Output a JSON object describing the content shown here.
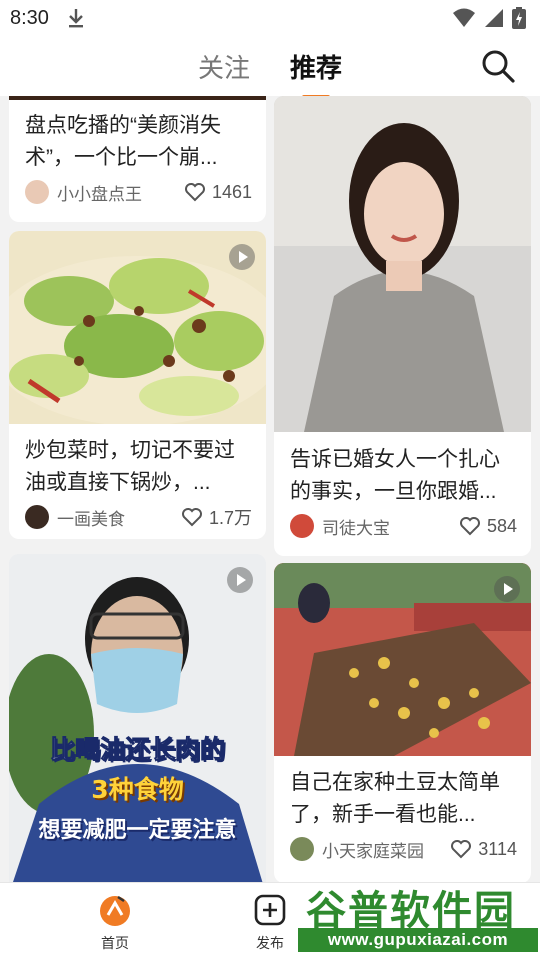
{
  "status": {
    "time": "8:30"
  },
  "tabs": [
    {
      "label": "关注"
    },
    {
      "label": "推荐"
    }
  ],
  "cards": [
    {
      "title": "盘点吃播的“美颜消失术”，一个比一个崩...",
      "author": "小小盘点王",
      "likes": "1461"
    },
    {
      "title": "炒包菜时，切记不要过油或直接下锅炒，...",
      "author": "一画美食",
      "likes": "1.7万"
    },
    {
      "title": "告诉已婚女人一个扎心的事实，一旦你跟婚...",
      "author": "司徒大宝",
      "likes": "584"
    },
    {
      "title": "",
      "author": "",
      "likes": "",
      "overlay": [
        "比喝油还长肉的",
        "3种食物",
        "想要减肥一定要注意"
      ]
    },
    {
      "title": "自己在家种土豆太简单了，新手一看也能...",
      "author": "小天家庭菜园",
      "likes": "3114"
    }
  ],
  "bottom_nav": [
    {
      "label": "首页"
    },
    {
      "label": "发布"
    }
  ],
  "watermark": {
    "title": "谷普软件园",
    "url": "www.gupuxiazai.com"
  },
  "colors": {
    "accent": "#f07b24",
    "watermark": "#2f8a2f"
  }
}
